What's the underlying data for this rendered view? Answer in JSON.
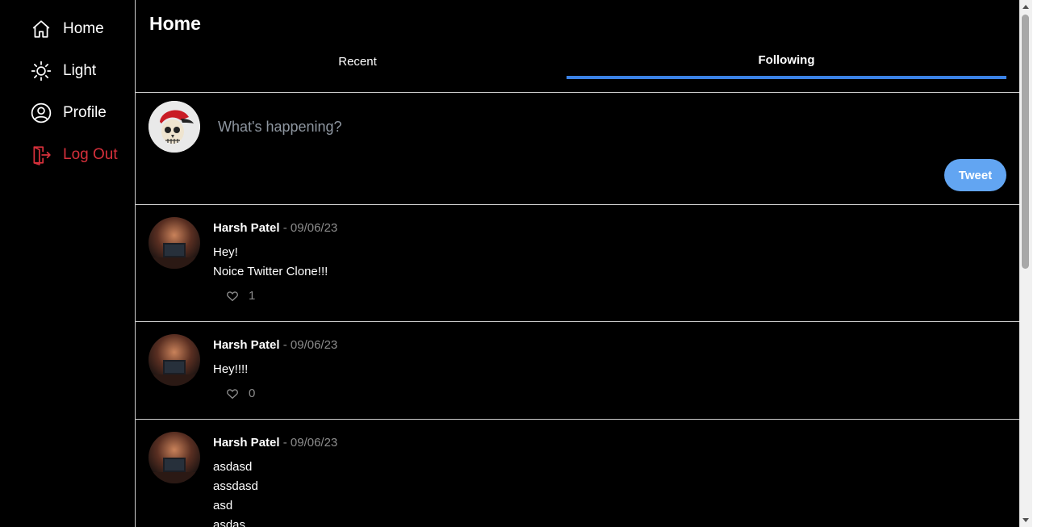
{
  "sidebar": {
    "items": [
      {
        "label": "Home",
        "icon": "home-icon"
      },
      {
        "label": "Light",
        "icon": "sun-icon"
      },
      {
        "label": "Profile",
        "icon": "user-circle-icon"
      },
      {
        "label": "Log Out",
        "icon": "logout-icon",
        "color": "#d6303b"
      }
    ]
  },
  "header": {
    "title": "Home",
    "tabs": [
      {
        "label": "Recent",
        "active": false
      },
      {
        "label": "Following",
        "active": true
      }
    ],
    "accent": "#3b82e6"
  },
  "composer": {
    "placeholder": "What's happening?",
    "button_label": "Tweet",
    "button_color": "#62a5f2"
  },
  "tweets": [
    {
      "author": "Harsh Patel",
      "date": "- 09/06/23",
      "lines": [
        "Hey!",
        "Noice Twitter Clone!!!"
      ],
      "likes": "1"
    },
    {
      "author": "Harsh Patel",
      "date": "- 09/06/23",
      "lines": [
        "Hey!!!!"
      ],
      "likes": "0"
    },
    {
      "author": "Harsh Patel",
      "date": "- 09/06/23",
      "lines": [
        "asdasd",
        "assdasd",
        "asd",
        "asdas"
      ],
      "likes": ""
    }
  ]
}
